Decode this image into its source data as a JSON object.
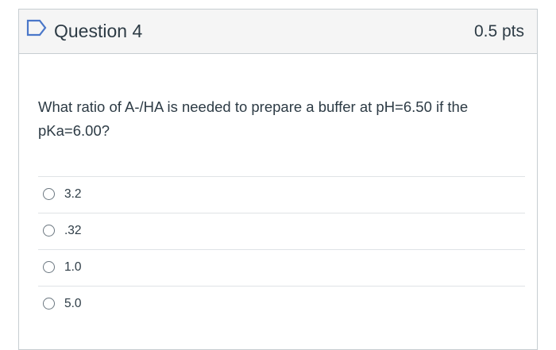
{
  "question": {
    "title": "Question 4",
    "points": "0.5 pts",
    "flag_icon": "flag-outline-icon",
    "text": "What ratio of A-/HA is needed to prepare a buffer at pH=6.50 if the pKa=6.00?",
    "answers": [
      {
        "label": "3.2"
      },
      {
        "label": ".32"
      },
      {
        "label": "1.0"
      },
      {
        "label": "5.0"
      }
    ]
  },
  "colors": {
    "header_bg": "#f5f5f5",
    "border": "#c7cdd1",
    "text": "#2d3b45",
    "flag": "#4a77c9"
  }
}
